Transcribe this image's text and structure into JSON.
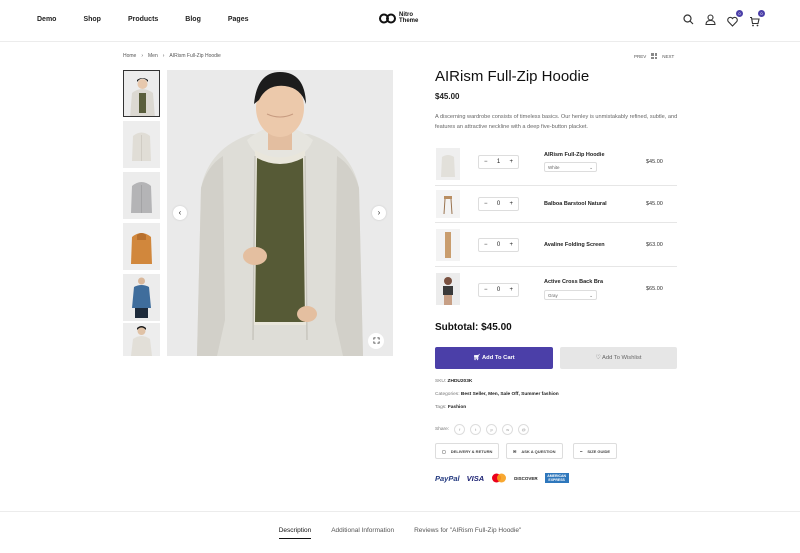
{
  "header": {
    "nav": [
      "Demo",
      "Shop",
      "Products",
      "Blog",
      "Pages"
    ],
    "logo_line1": "Nitro",
    "logo_line2": "Theme",
    "wishlist_count": "0",
    "cart_count": "0"
  },
  "breadcrumb": [
    "Home",
    "Men",
    "AIRism Full-Zip Hoodie"
  ],
  "pager": {
    "prev": "PREV",
    "next": "NEXT"
  },
  "product": {
    "title": "AIRism Full-Zip Hoodie",
    "price": "$45.00",
    "description": "A discerning wardrobe consists of timeless basics. Our henley is unmistakably refined, subtle, and features an attractive neckline with a deep five-button placket."
  },
  "bundle": [
    {
      "name": "AIRism Full-Zip Hoodie",
      "qty": "1",
      "option": "White",
      "price": "$45.00"
    },
    {
      "name": "Balboa Barstool Natural",
      "qty": "0",
      "option": "",
      "price": "$45.00"
    },
    {
      "name": "Avaline Folding Screen",
      "qty": "0",
      "option": "",
      "price": "$63.00"
    },
    {
      "name": "Active Cross Back Bra",
      "qty": "0",
      "option": "Gray",
      "price": "$65.00"
    }
  ],
  "subtotal": "Subtotal: $45.00",
  "buttons": {
    "add_to_cart": "Add To Cart",
    "add_to_wishlist": "Add To Wishlist"
  },
  "meta": {
    "sku_label": "SKU:",
    "sku": "ZHDU203K",
    "categories_label": "Categories:",
    "categories": "Best Seller, Men, Sale Off, Summer fashion",
    "tags_label": "Tags:",
    "tags": "Fashion",
    "share_label": "Share:"
  },
  "info_pills": [
    "DELIVERY & RETURN",
    "ASK A QUESTION",
    "SIZE GUIDE"
  ],
  "payment": [
    "PayPal",
    "VISA",
    "DISCOVER",
    "AMERICAN EXPRESS"
  ],
  "tabs": [
    "Description",
    "Additional Information",
    "Reviews for \"AIRism Full-Zip Hoodie\""
  ],
  "colors": {
    "accent": "#4b3fa8",
    "wishlist_bg": "#e6e6e6"
  }
}
